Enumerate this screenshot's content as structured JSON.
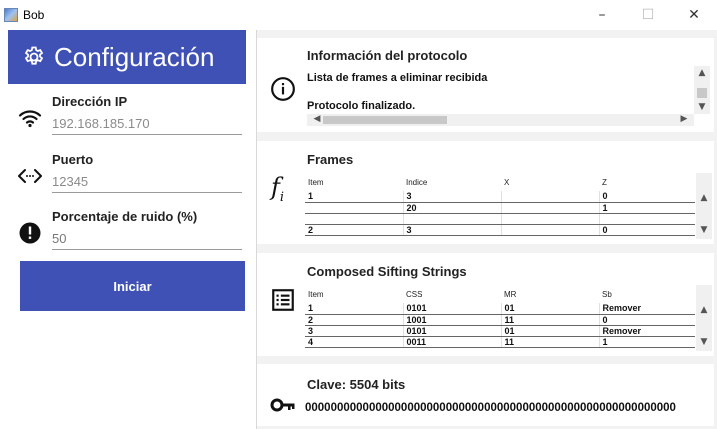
{
  "window": {
    "title": "Bob",
    "controls": {
      "minimize": "–",
      "maximize": "☐",
      "close": "✕"
    }
  },
  "config": {
    "title": "Configuración",
    "ip": {
      "label": "Dirección IP",
      "placeholder": "192.168.185.170"
    },
    "port": {
      "label": "Puerto",
      "placeholder": "12345"
    },
    "noise": {
      "label": "Porcentaje de ruido (%)",
      "value": "50"
    },
    "start_label": "Iniciar"
  },
  "protocol_info": {
    "title": "Información del protocolo",
    "lines": [
      "Lista de frames a eliminar recibida",
      "",
      "Protocolo finalizado."
    ]
  },
  "frames": {
    "title": "Frames",
    "columns": [
      "Item",
      "Indice",
      "X",
      "Z"
    ],
    "rows": [
      [
        "1",
        "3",
        "",
        "0"
      ],
      [
        "",
        "20",
        "",
        "1"
      ],
      [
        "",
        "",
        "",
        ""
      ],
      [
        "2",
        "3",
        "",
        "0"
      ]
    ]
  },
  "sifting": {
    "title": "Composed Sifting Strings",
    "columns": [
      "Item",
      "CSS",
      "MR",
      "Sb"
    ],
    "rows": [
      [
        "1",
        "0101",
        "01",
        "Remover"
      ],
      [
        "2",
        "1001",
        "11",
        "0"
      ],
      [
        "3",
        "0101",
        "01",
        "Remover"
      ],
      [
        "4",
        "0011",
        "11",
        "1"
      ]
    ]
  },
  "key": {
    "title": "Clave: 5504 bits",
    "bits": "0000000000000000000000000000000000000000000000000000000000"
  },
  "colors": {
    "accent": "#3f51b5",
    "panel_bg": "#f2f2f2"
  }
}
